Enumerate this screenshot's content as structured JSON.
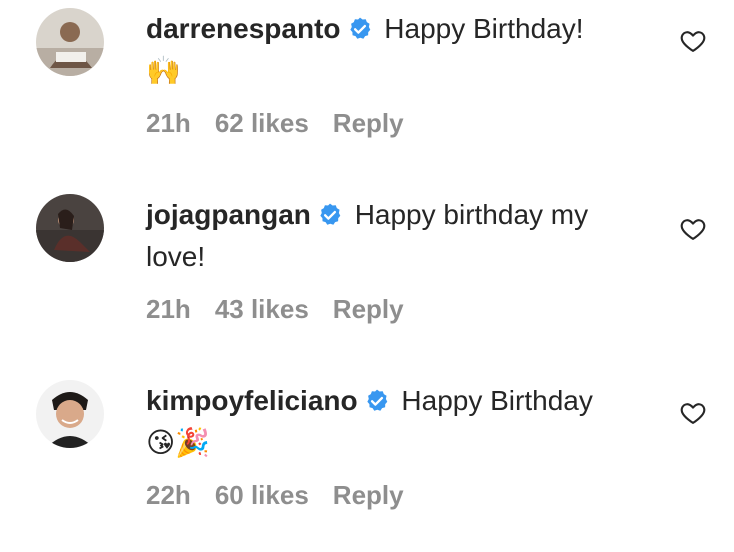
{
  "comments": [
    {
      "username": "darrenespanto",
      "text": "Happy Birthday!",
      "emoji": "🙌",
      "time": "21h",
      "likes": "62 likes",
      "reply_label": "Reply"
    },
    {
      "username": "jojagpangan",
      "text": "Happy birthday my love!",
      "emoji": "",
      "time": "21h",
      "likes": "43 likes",
      "reply_label": "Reply"
    },
    {
      "username": "kimpoyfeliciano",
      "text": "Happy Birthday",
      "emoji": "😘🎉",
      "time": "22h",
      "likes": "60 likes",
      "reply_label": "Reply"
    }
  ],
  "colors": {
    "verified_badge": "#3897f0",
    "meta_text": "#8e8e8e",
    "primary_text": "#262626"
  },
  "icons": {
    "verified": "verified-badge-icon",
    "like": "heart-outline-icon"
  }
}
